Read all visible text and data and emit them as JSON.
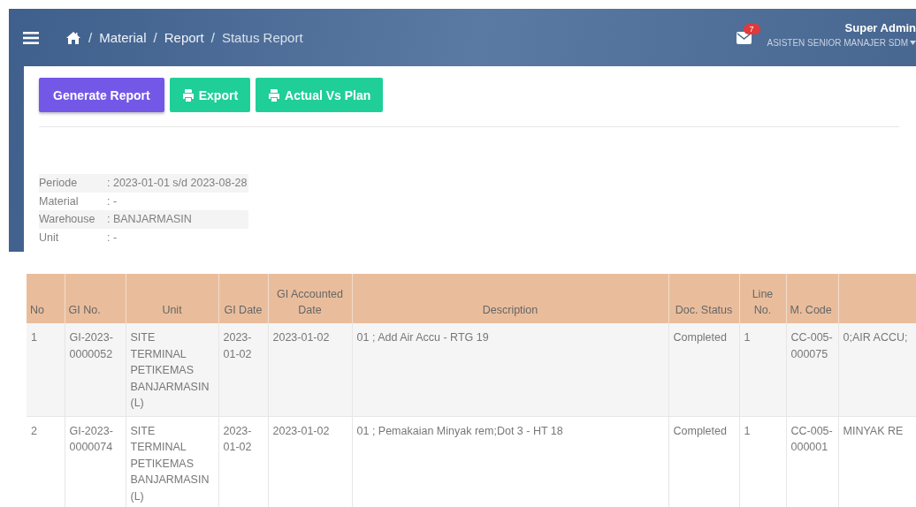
{
  "header": {
    "breadcrumb": [
      {
        "separator": "/",
        "label": "Material",
        "current": false
      },
      {
        "separator": "/",
        "label": "Report",
        "current": false
      },
      {
        "separator": "/",
        "label": "Status Report",
        "current": true
      }
    ],
    "notifications": {
      "count": "7"
    },
    "user": {
      "name": "Super Admin",
      "role": "ASISTEN SENIOR MANAJER SDM"
    }
  },
  "toolbar": {
    "buttons": [
      {
        "label": "Generate Report",
        "kind": "primary"
      },
      {
        "label": "Export",
        "kind": "print"
      },
      {
        "label": "Actual Vs Plan",
        "kind": "print"
      }
    ]
  },
  "filters": [
    {
      "label": "Periode",
      "value": ": 2023-01-01 s/d 2023-08-28"
    },
    {
      "label": "Material",
      "value": ": -"
    },
    {
      "label": "Warehouse",
      "value": ": BANJARMASIN"
    },
    {
      "label": "Unit",
      "value": ": -"
    }
  ],
  "table": {
    "columns": [
      "No",
      "GI No.",
      "Unit",
      "GI Date",
      "GI Accounted Date",
      "Description",
      "Doc. Status",
      "Line No.",
      "M. Code"
    ],
    "rows": [
      [
        "1",
        "GI-2023-0000052",
        "SITE TERMINAL PETIKEMAS BANJARMASIN (L)",
        "2023-01-02",
        "2023-01-02",
        "01 ; Add Air Accu - RTG 19",
        "Completed",
        "1",
        "CC-005-000075",
        "0;AIR ACCU;"
      ],
      [
        "2",
        "GI-2023-0000074",
        "SITE TERMINAL PETIKEMAS BANJARMASIN (L)",
        "2023-01-02",
        "2023-01-02",
        "01 ; Pemakaian Minyak rem;Dot 3 - HT 18",
        "Completed",
        "1",
        "CC-005-000001",
        "MINYAK RE"
      ]
    ]
  }
}
